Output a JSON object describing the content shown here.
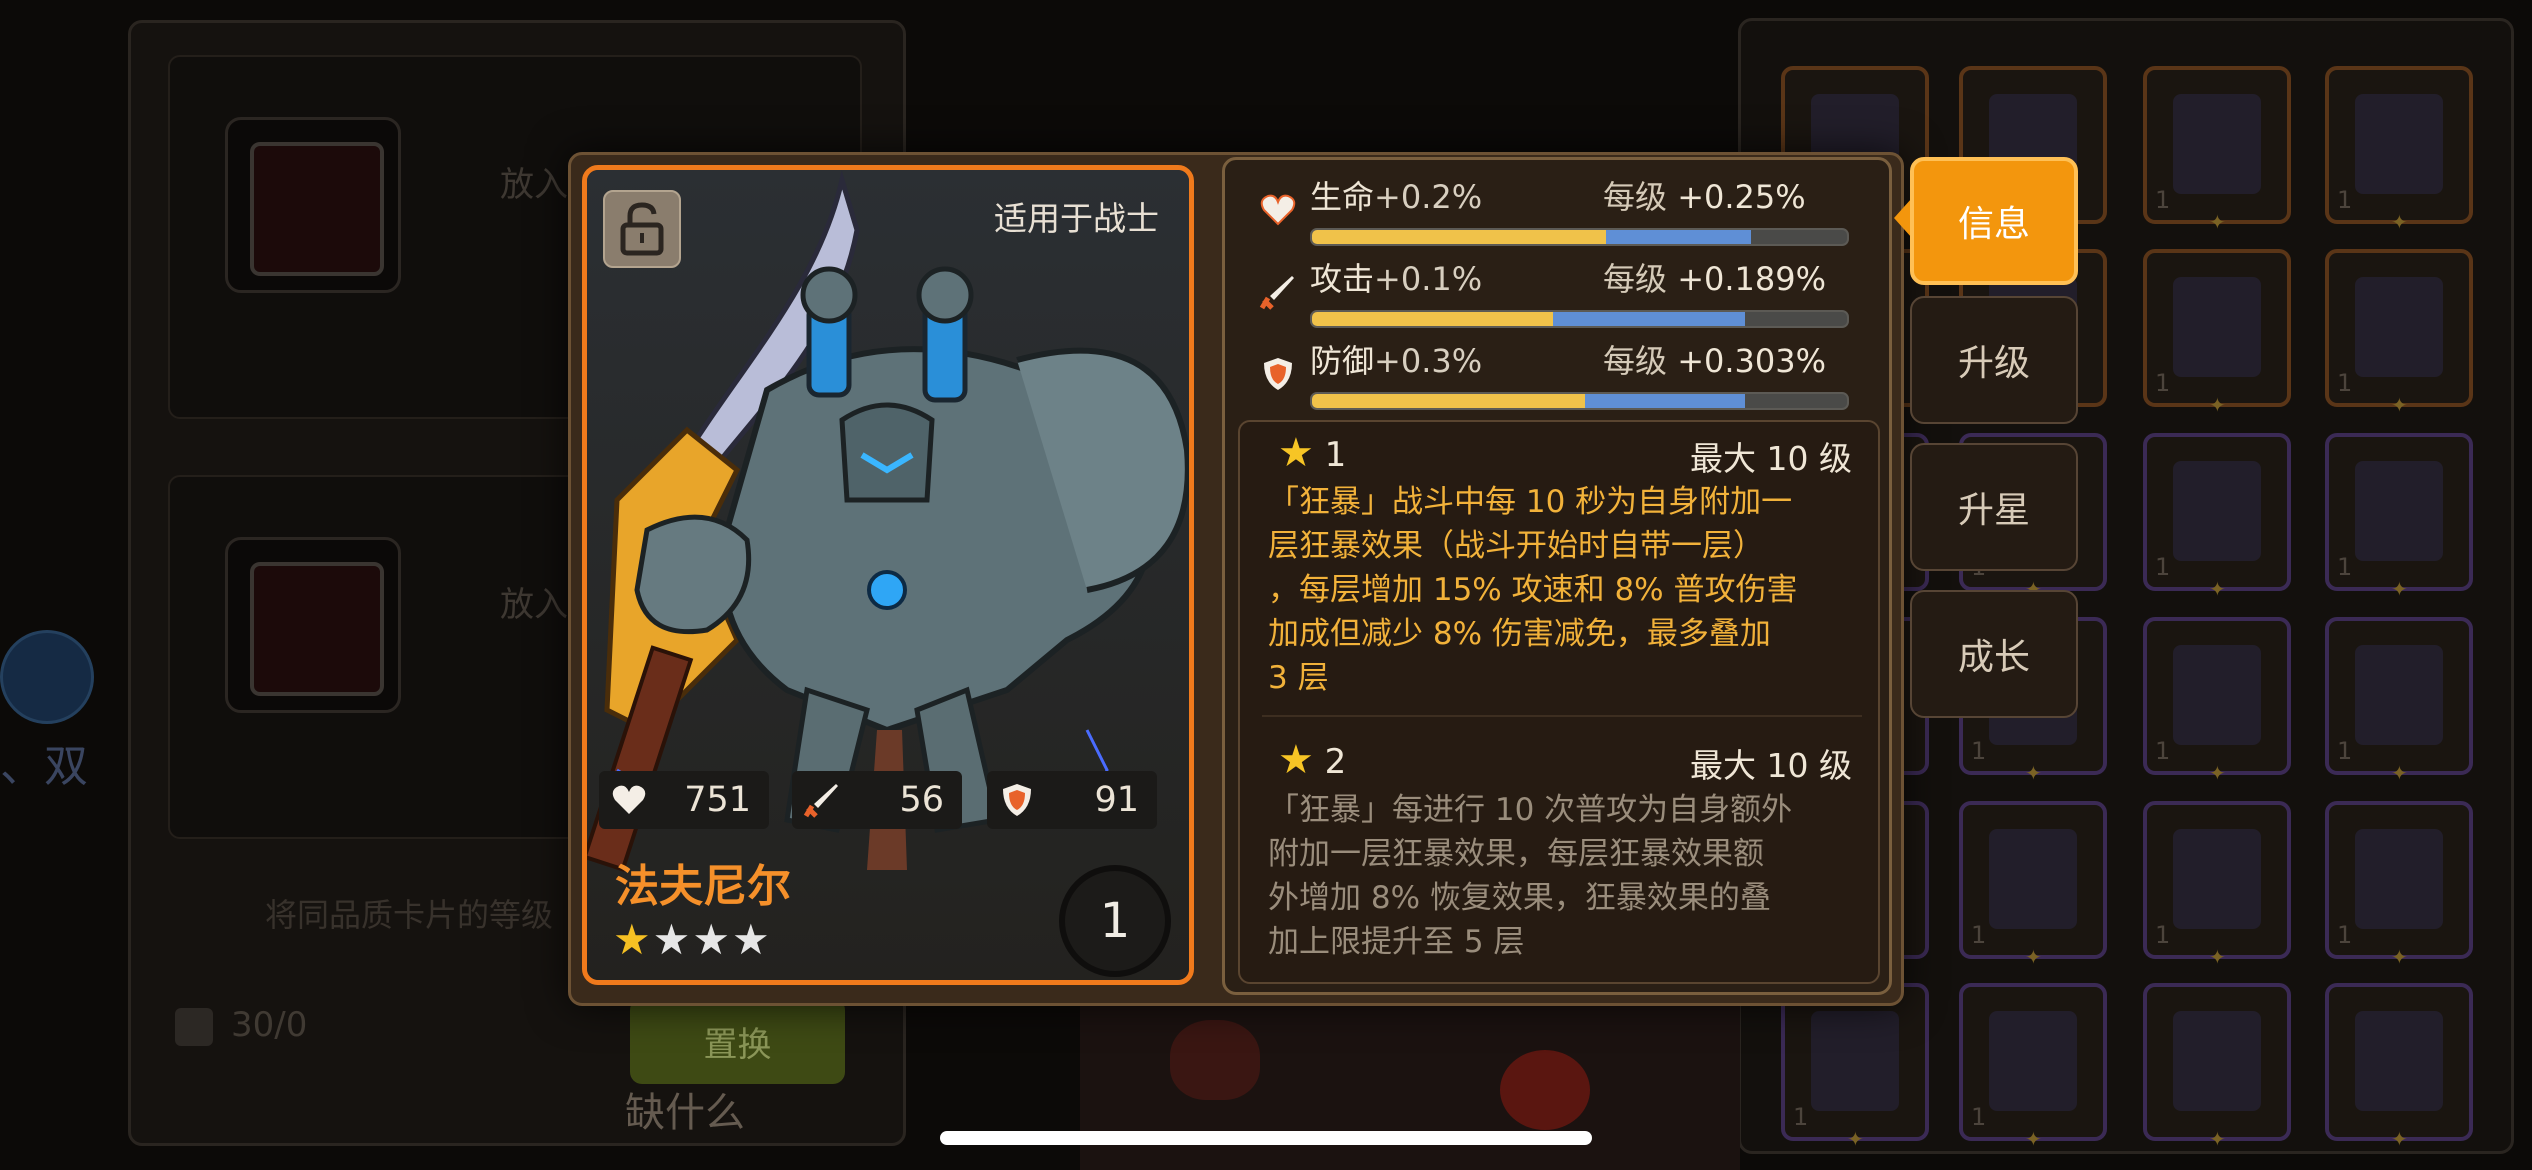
{
  "background": {
    "put_label": "放入",
    "hint": "将同品质卡片的等级",
    "count": "30/0",
    "swap_button": "置换",
    "chat_text": "缺什么",
    "twin_text": "、双",
    "grid_counts": [
      "1",
      "1",
      "1",
      "1",
      "1",
      "1",
      "1",
      "1",
      "1",
      "1",
      "1",
      "1",
      "1",
      "1",
      "1",
      "1",
      "1",
      "1",
      "1",
      "1"
    ]
  },
  "card": {
    "applies_to": "适用于战士",
    "name": "法夫尼尔",
    "level": "1",
    "stars_filled": 1,
    "stars_total": 4,
    "stats": {
      "hp": "751",
      "attack": "56",
      "defense": "91"
    }
  },
  "attributes": [
    {
      "label": "生命",
      "bonus": "+0.2%",
      "per_level_label": "每级",
      "per_level": "+0.25%",
      "yellow": 0.55,
      "blue": 0.27,
      "icon": "heart-icon"
    },
    {
      "label": "攻击",
      "bonus": "+0.1%",
      "per_level_label": "每级",
      "per_level": "+0.189%",
      "yellow": 0.45,
      "blue": 0.36,
      "icon": "sword-icon"
    },
    {
      "label": "防御",
      "bonus": "+0.3%",
      "per_level_label": "每级",
      "per_level": "+0.303%",
      "yellow": 0.51,
      "blue": 0.3,
      "icon": "shield-icon"
    }
  ],
  "skills": [
    {
      "star": "★",
      "num": "1",
      "max": "最大 10 级",
      "lines": [
        "「狂暴」战斗中每 10 秒为自身附加一",
        "层狂暴效果（战斗开始时自带一层）",
        "，每层增加 15% 攻速和 8% 普攻伤害",
        "加成但减少 8% 伤害减免，最多叠加",
        " 3 层"
      ]
    },
    {
      "star": "★",
      "num": "2",
      "max": "最大 10 级",
      "lines": [
        "「狂暴」每进行 10 次普攻为自身额外",
        "附加一层狂暴效果，每层狂暴效果额",
        "外增加 8% 恢复效果，狂暴效果的叠",
        "加上限提升至 5 层"
      ]
    }
  ],
  "tabs": [
    {
      "label": "信息",
      "active": true
    },
    {
      "label": "升级",
      "active": false
    },
    {
      "label": "升星",
      "active": false
    },
    {
      "label": "成长",
      "active": false
    }
  ],
  "colors": {
    "accent": "#f3960d",
    "card_border": "#f07a1c",
    "name": "#f5902a",
    "star": "#f5c023"
  }
}
